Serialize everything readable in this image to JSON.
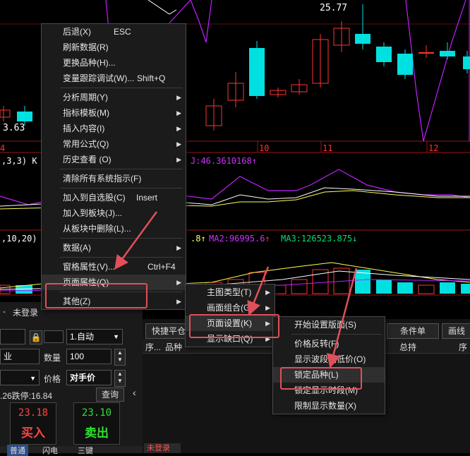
{
  "chart": {
    "price_label_top": "25.77",
    "price_label_left": "3.63",
    "date_labels": [
      "4",
      "10",
      "11",
      "12"
    ],
    "kdj_left_label": ",3,3) K",
    "kdj_j_label": "J:46.3610168",
    "vol_left_label": ",10,20)",
    "vol_ma_frag": ".8",
    "vol_ma2_label": "MA2:96995.6",
    "vol_ma3_label": "MA3:126523.875",
    "colors": {
      "up": "#ff3333",
      "down": "#00e0e0",
      "kdj_k": "#ffffff",
      "kdj_d": "#ffff55",
      "kdj_j": "#d030ff",
      "grid": "#7a1010"
    }
  },
  "context_menu": {
    "items": [
      {
        "label": "后退(X)",
        "shortcut": "ESC"
      },
      {
        "label": "刷新数据(R)"
      },
      {
        "label": "更换品种(H)..."
      },
      {
        "label": "变量跟踪调试(W)...",
        "shortcut": "Shift+Q"
      },
      {
        "label": "分析周期(Y)"
      },
      {
        "label": "指标模板(M)"
      },
      {
        "label": "插入内容(I)"
      },
      {
        "label": "常用公式(Q)"
      },
      {
        "label": "历史查看 (O)"
      },
      {
        "label": "清除所有系统指示(F)"
      },
      {
        "label": "加入到自选股(C)",
        "shortcut": "Insert"
      },
      {
        "label": "加入到板块(J)..."
      },
      {
        "label": "从板块中删除(L)..."
      },
      {
        "label": "数据(A)"
      },
      {
        "label": "窗格属性(V)...",
        "shortcut": "Ctrl+F4"
      },
      {
        "label": "页面属性(Q)"
      },
      {
        "label": "其他(Z)"
      }
    ]
  },
  "submenu_page": {
    "items": [
      {
        "label": "主图类型(T)"
      },
      {
        "label": "画面组合(G)"
      },
      {
        "label": "页面设置(K)"
      },
      {
        "label": "显示缺口(Q)"
      }
    ]
  },
  "submenu_settings": {
    "items": [
      {
        "label": "开始设置版面(S)"
      },
      {
        "label": "价格反转(F)"
      },
      {
        "label": "显示波段高低价(O)"
      },
      {
        "label": "锁定品种(L)"
      },
      {
        "label": "锁定显示时段(M)"
      },
      {
        "label": "限制显示数量(X)"
      }
    ]
  },
  "order_panel": {
    "status": "未登录",
    "mode_select": "1.自动",
    "side_label": "业",
    "qty_label": "数量",
    "qty_value": "100",
    "price_label": "价格",
    "price_value": "对手价",
    "limit_text": ".26跌停:16.84",
    "query_btn": "查询",
    "buy_price": "23.18",
    "buy_label": "买入",
    "sell_price": "23.10",
    "sell_label": "卖出",
    "bottom_tabs": [
      "普通",
      "闪电",
      "三键"
    ]
  },
  "right_panel": {
    "quick_btn": "快捷平仓",
    "cond_btn": "条件单",
    "draw_btn": "画线",
    "col_seq": "序...",
    "col_variety": "品种",
    "col_total": "总持",
    "col_seq2": "序",
    "bottom_tab": "未登录"
  }
}
